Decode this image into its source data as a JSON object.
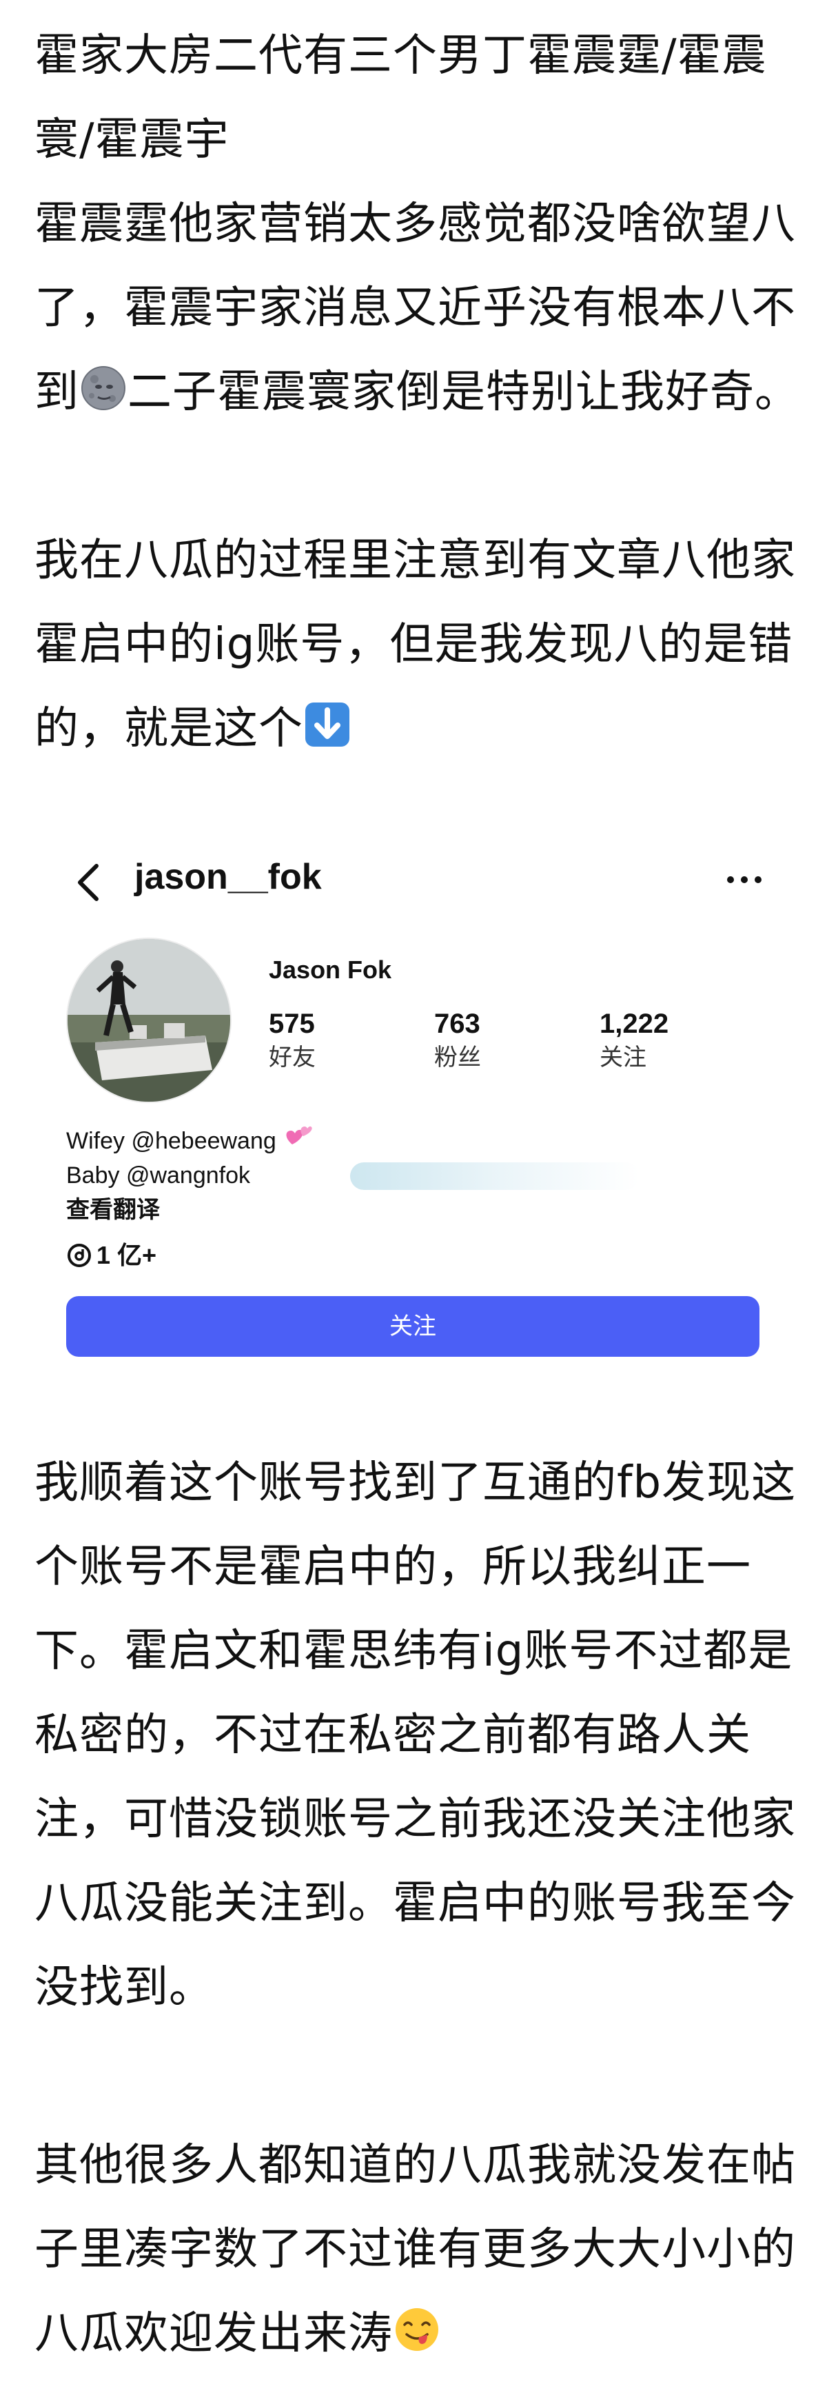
{
  "post": {
    "paragraph1": "霍家大房二代有三个男丁霍震霆/霍震寰/霍震宇",
    "paragraph2_a": "霍震霆他家营销太多感觉都没啥欲望八了，霍震宇家消息又近乎没有根本八不到",
    "paragraph2_b": "二子霍震寰家倒是特别让我好奇。",
    "paragraph3_a": "我在八瓜的过程里注意到有文章八他家霍启中的ig账号，但是我发现八的是错的，就是这个",
    "paragraph4": "我顺着这个账号找到了互通的fb发现这个账号不是霍启中的，所以我纠正一下。霍启文和霍思纬有ig账号不过都是私密的，不过在私密之前都有路人关注，可惜没锁账号之前我还没关注他家八瓜没能关注到。霍启中的账号我至今没找到。",
    "paragraph5_a": "其他很多人都知道的八瓜我就没发在帖子里凑字数了不过谁有更多大大小小的八瓜欢迎发出来涛",
    "emoji_1": "new-moon-face-emoji",
    "emoji_2": "down-arrow-emoji",
    "emoji_3": "yum-face-emoji"
  },
  "screenshot": {
    "username": "jason__fok",
    "display_name": "Jason Fok",
    "stats": [
      {
        "value": "575",
        "label": "好友"
      },
      {
        "value": "763",
        "label": "粉丝"
      },
      {
        "value": "1,222",
        "label": "关注"
      }
    ],
    "bio_line1": "Wifey @hebeewang",
    "bio_line2": "Baby @wangnfok",
    "see_translation": "查看翻译",
    "threads_count": "1 亿+",
    "follow_button": "关注",
    "accent_color": "#4b5ff6"
  }
}
